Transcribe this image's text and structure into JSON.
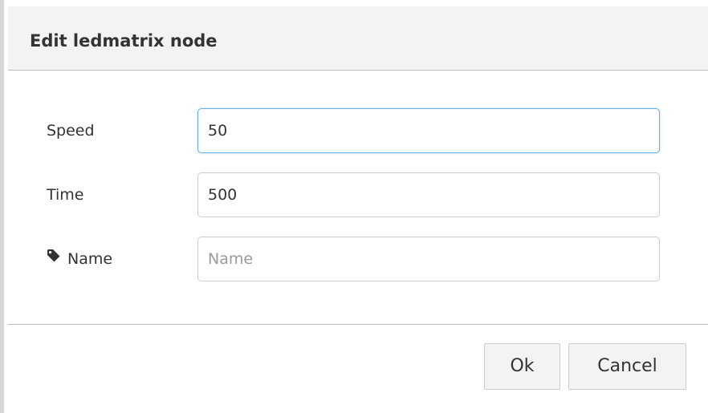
{
  "dialog": {
    "title": "Edit ledmatrix node"
  },
  "form": {
    "speed": {
      "label": "Speed",
      "value": "50"
    },
    "time": {
      "label": "Time",
      "value": "500"
    },
    "name": {
      "label": "Name",
      "value": "",
      "placeholder": "Name",
      "icon": "tag-icon"
    }
  },
  "buttons": {
    "ok_label": "Ok",
    "cancel_label": "Cancel"
  },
  "colors": {
    "focus_border": "#66afe9",
    "header_bg": "#f3f3f3"
  }
}
